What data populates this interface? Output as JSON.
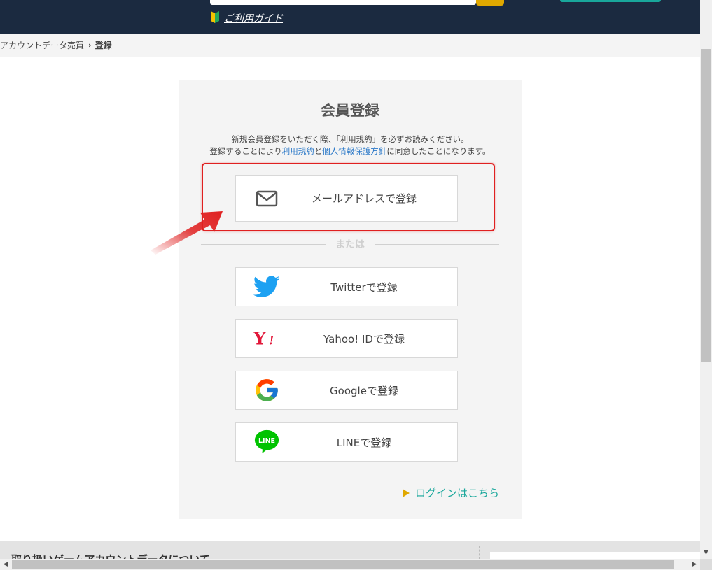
{
  "header": {
    "guide_label": "ご利用ガイド"
  },
  "breadcrumb": {
    "parent": "アカウントデータ売買",
    "current": "登録"
  },
  "card": {
    "title": "会員登録",
    "notice_line1": "新規会員登録をいただく際、「利用規約」を必ずお読みください。",
    "notice_line2_pre": "登録することにより",
    "terms_link": "利用規約",
    "notice_line2_mid": "と",
    "privacy_link": "個人情報保護方針",
    "notice_line2_post": "に同意したことになります。",
    "divider_label": "または",
    "login_link": "ログインはこちら"
  },
  "buttons": {
    "email": "メールアドレスで登録",
    "twitter": "Twitterで登録",
    "yahoo": "Yahoo! IDで登録",
    "google": "Googleで登録",
    "line": "LINEで登録"
  },
  "icons": {
    "email": "mail-icon",
    "twitter": "twitter-bird-icon",
    "yahoo": "yahoo-logo-icon",
    "google": "google-g-icon",
    "line": "line-logo-icon"
  },
  "colors": {
    "header_bg": "#1b2a40",
    "accent_teal": "#19a79b",
    "accent_yellow": "#e0a800",
    "highlight_red": "#e02020",
    "twitter_blue": "#1da1f2",
    "yahoo_red": "#e2183a",
    "line_green": "#00c300"
  },
  "footer": {
    "section_heading_partial": "取り扱いゲームアカウントデータについて"
  }
}
